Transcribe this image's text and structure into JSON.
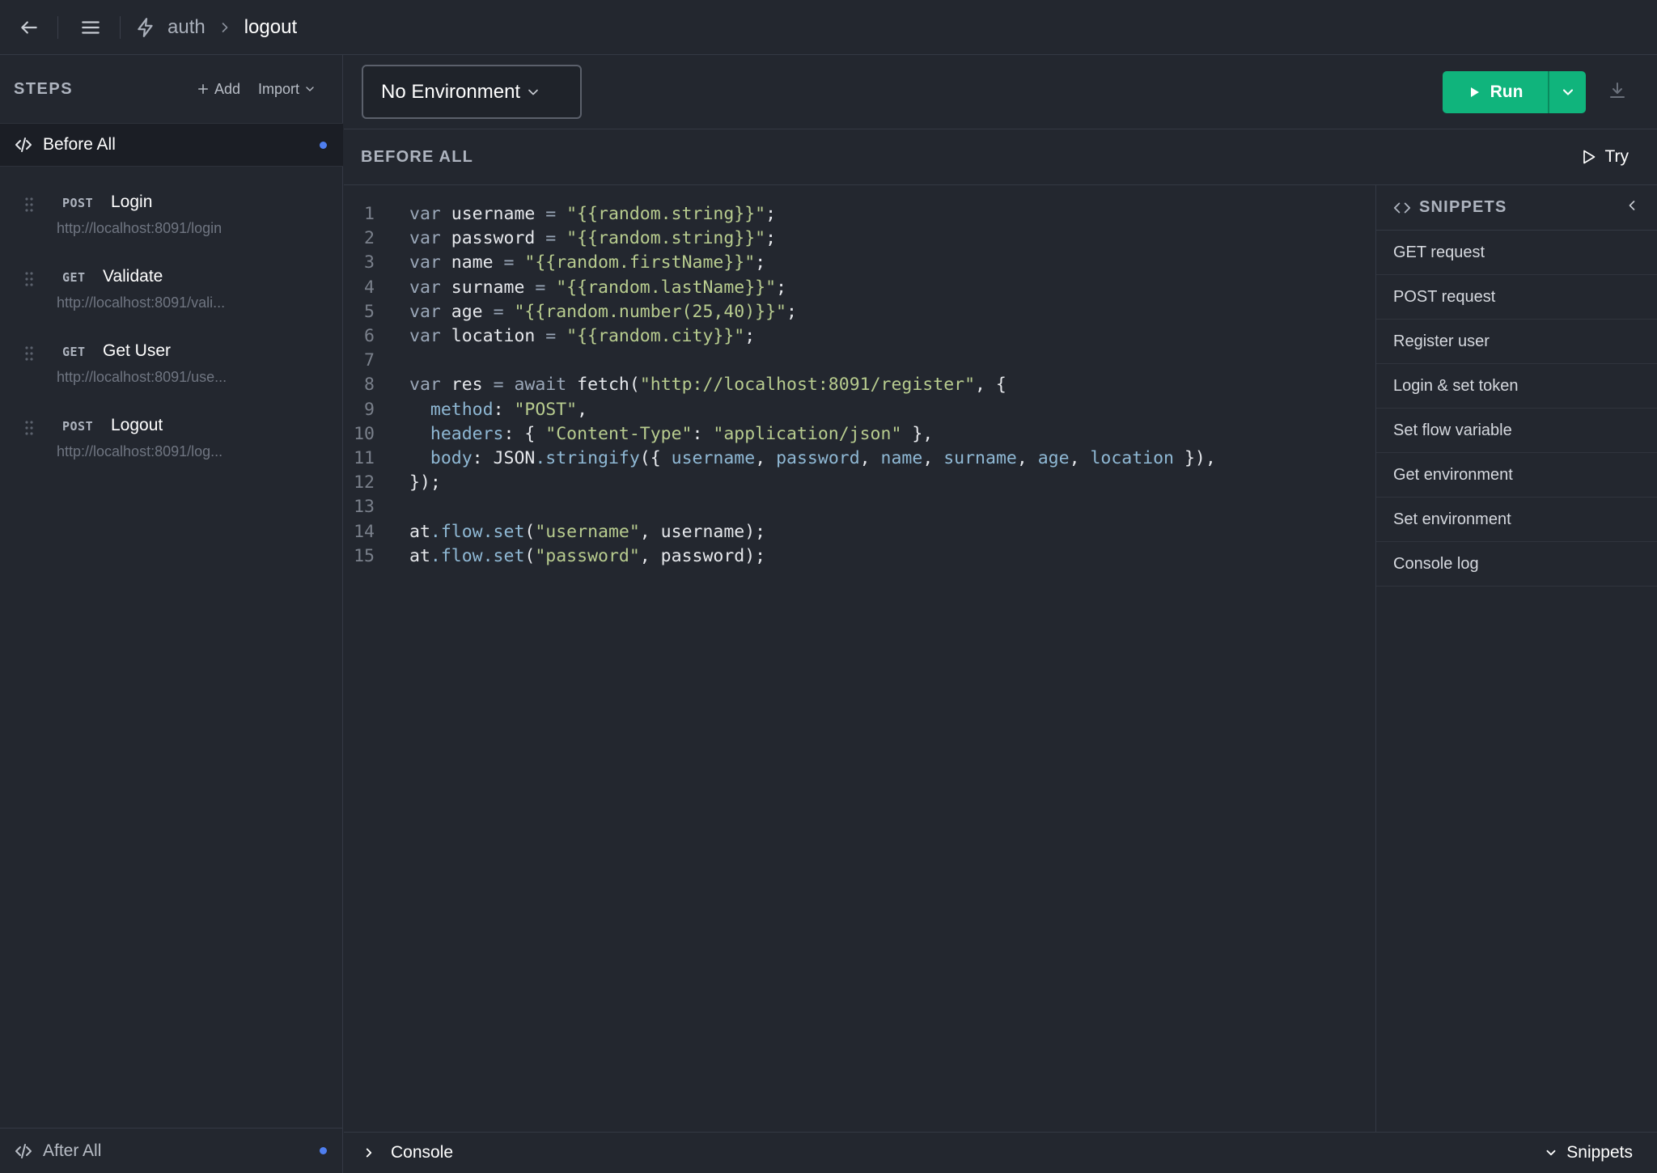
{
  "breadcrumb": {
    "parent": "auth",
    "current": "logout"
  },
  "steps": {
    "title": "STEPS",
    "add_label": "Add",
    "import_label": "Import",
    "before_all": "Before All",
    "after_all": "After All",
    "items": [
      {
        "method": "POST",
        "name": "Login",
        "url": "http://localhost:8091/login"
      },
      {
        "method": "GET",
        "name": "Validate",
        "url": "http://localhost:8091/vali..."
      },
      {
        "method": "GET",
        "name": "Get User",
        "url": "http://localhost:8091/use..."
      },
      {
        "method": "POST",
        "name": "Logout",
        "url": "http://localhost:8091/log..."
      }
    ]
  },
  "environment": {
    "selected": "No Environment"
  },
  "run": {
    "label": "Run"
  },
  "section": {
    "title": "BEFORE ALL",
    "try_label": "Try"
  },
  "editor": {
    "lines": [
      {
        "n": "1",
        "tokens": [
          [
            "kw",
            "var "
          ],
          [
            "id",
            "username "
          ],
          [
            "op",
            "= "
          ],
          [
            "str",
            "\"{{random.string}}\""
          ],
          [
            "pn",
            ";"
          ]
        ]
      },
      {
        "n": "2",
        "tokens": [
          [
            "kw",
            "var "
          ],
          [
            "id",
            "password "
          ],
          [
            "op",
            "= "
          ],
          [
            "str",
            "\"{{random.string}}\""
          ],
          [
            "pn",
            ";"
          ]
        ]
      },
      {
        "n": "3",
        "tokens": [
          [
            "kw",
            "var "
          ],
          [
            "id",
            "name "
          ],
          [
            "op",
            "= "
          ],
          [
            "str",
            "\"{{random.firstName}}\""
          ],
          [
            "pn",
            ";"
          ]
        ]
      },
      {
        "n": "4",
        "tokens": [
          [
            "kw",
            "var "
          ],
          [
            "id",
            "surname "
          ],
          [
            "op",
            "= "
          ],
          [
            "str",
            "\"{{random.lastName}}\""
          ],
          [
            "pn",
            ";"
          ]
        ]
      },
      {
        "n": "5",
        "tokens": [
          [
            "kw",
            "var "
          ],
          [
            "id",
            "age "
          ],
          [
            "op",
            "= "
          ],
          [
            "str",
            "\"{{random.number(25,40)}}\""
          ],
          [
            "pn",
            ";"
          ]
        ]
      },
      {
        "n": "6",
        "tokens": [
          [
            "kw",
            "var "
          ],
          [
            "id",
            "location "
          ],
          [
            "op",
            "= "
          ],
          [
            "str",
            "\"{{random.city}}\""
          ],
          [
            "pn",
            ";"
          ]
        ]
      },
      {
        "n": "7",
        "tokens": []
      },
      {
        "n": "8",
        "tokens": [
          [
            "kw",
            "var "
          ],
          [
            "id",
            "res "
          ],
          [
            "op",
            "= "
          ],
          [
            "kw",
            "await "
          ],
          [
            "id",
            "fetch"
          ],
          [
            "pn",
            "("
          ],
          [
            "str",
            "\"http://localhost:8091/register\""
          ],
          [
            "pn",
            ", {"
          ]
        ]
      },
      {
        "n": "9",
        "tokens": [
          [
            "pn",
            "  "
          ],
          [
            "prop",
            "method"
          ],
          [
            "pn",
            ": "
          ],
          [
            "str",
            "\"POST\""
          ],
          [
            "pn",
            ","
          ]
        ]
      },
      {
        "n": "10",
        "tokens": [
          [
            "pn",
            "  "
          ],
          [
            "prop",
            "headers"
          ],
          [
            "pn",
            ": { "
          ],
          [
            "str",
            "\"Content-Type\""
          ],
          [
            "pn",
            ": "
          ],
          [
            "str",
            "\"application/json\""
          ],
          [
            "pn",
            " },"
          ]
        ]
      },
      {
        "n": "11",
        "tokens": [
          [
            "pn",
            "  "
          ],
          [
            "prop",
            "body"
          ],
          [
            "pn",
            ": "
          ],
          [
            "id",
            "JSON"
          ],
          [
            "fn",
            ".stringify"
          ],
          [
            "pn",
            "({ "
          ],
          [
            "prop",
            "username"
          ],
          [
            "pn",
            ", "
          ],
          [
            "prop",
            "password"
          ],
          [
            "pn",
            ", "
          ],
          [
            "prop",
            "name"
          ],
          [
            "pn",
            ", "
          ],
          [
            "prop",
            "surname"
          ],
          [
            "pn",
            ", "
          ],
          [
            "prop",
            "age"
          ],
          [
            "pn",
            ", "
          ],
          [
            "prop",
            "location"
          ],
          [
            "pn",
            " }),"
          ]
        ]
      },
      {
        "n": "12",
        "tokens": [
          [
            "pn",
            "});"
          ]
        ]
      },
      {
        "n": "13",
        "tokens": []
      },
      {
        "n": "14",
        "tokens": [
          [
            "id",
            "at"
          ],
          [
            "fn",
            ".flow.set"
          ],
          [
            "pn",
            "("
          ],
          [
            "str",
            "\"username\""
          ],
          [
            "pn",
            ", username);"
          ]
        ]
      },
      {
        "n": "15",
        "tokens": [
          [
            "id",
            "at"
          ],
          [
            "fn",
            ".flow.set"
          ],
          [
            "pn",
            "("
          ],
          [
            "str",
            "\"password\""
          ],
          [
            "pn",
            ", password);"
          ]
        ]
      }
    ]
  },
  "snippets": {
    "title": "SNIPPETS",
    "items": [
      "GET request",
      "POST request",
      "Register user",
      "Login & set token",
      "Set flow variable",
      "Get environment",
      "Set environment",
      "Console log"
    ]
  },
  "bottom": {
    "console_label": "Console",
    "snippets_label": "Snippets"
  },
  "colors": {
    "accent": "#10b47c",
    "status_dot": "#4f7ff0",
    "background": "#23272f"
  }
}
